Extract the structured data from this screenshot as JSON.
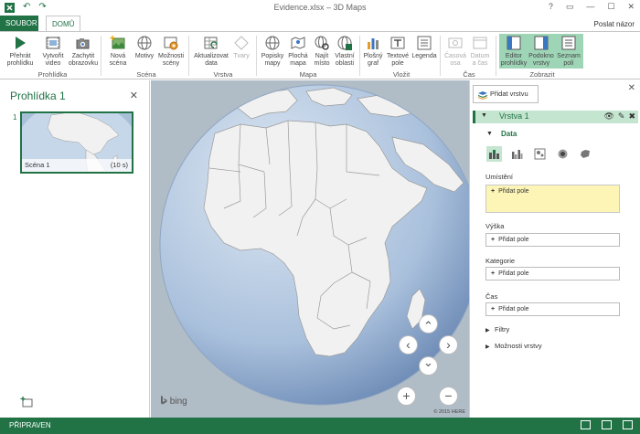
{
  "window": {
    "title": "Evidence.xlsx – 3D Maps",
    "help": "?",
    "restore": "▭",
    "minimize": "—",
    "maximize": "☐",
    "close": "✕"
  },
  "qat": {
    "undo": "↶",
    "redo": "↷"
  },
  "tabs": {
    "file": "SOUBOR",
    "home": "DOMŮ"
  },
  "signin": "Poslat názor",
  "ribbon": {
    "tour": {
      "play": "Přehrát prohlídku",
      "create_video": "Vytvořit video",
      "capture": "Zachytit obrazovku",
      "label": "Prohlídka"
    },
    "scene": {
      "new_scene": "Nová scéna",
      "themes": "Motivy",
      "options": "Možnosti scény",
      "label": "Scéna"
    },
    "layer": {
      "refresh": "Aktualizovat data",
      "shapes": "Tvary",
      "label": "Vrstva"
    },
    "map": {
      "labels": "Popisky mapy",
      "flat_map": "Plochá mapa",
      "find": "Najít místo",
      "custom": "Vlastní oblasti",
      "label": "Mapa"
    },
    "insert": {
      "flat_chart": "Plošný graf",
      "text_box": "Textové pole",
      "legend": "Legenda",
      "label": "Vložit"
    },
    "time": {
      "timeline": "Časová osa",
      "date_time": "Datum a čas",
      "label": "Čas"
    },
    "view": {
      "tour_editor": "Editor prohlídky",
      "layer_pane": "Podokno vrstvy",
      "field_list": "Seznam polí",
      "label": "Zobrazit"
    }
  },
  "left_panel": {
    "title": "Prohlídka 1",
    "close": "✕",
    "scenes": [
      {
        "index": "1",
        "name": "Scéna 1",
        "duration": "(10 s)"
      }
    ]
  },
  "map": {
    "bing": "bing",
    "copyright": "© 2015 HERE",
    "controls": {
      "up": "⌃",
      "down": "⌄",
      "left": "‹",
      "right": "›",
      "zoom_in": "+",
      "zoom_out": "−"
    }
  },
  "right_panel": {
    "close": "✕",
    "add_layer": "Přidat vrstvu",
    "layer_name": "Vrstva 1",
    "data_label": "Data",
    "fields": {
      "location": {
        "label": "Umístění",
        "placeholder": "Přidat pole"
      },
      "height": {
        "label": "Výška",
        "placeholder": "Přidat pole"
      },
      "category": {
        "label": "Kategorie",
        "placeholder": "Přidat pole"
      },
      "time": {
        "label": "Čas",
        "placeholder": "Přidat pole"
      }
    },
    "filters": "Filtry",
    "layer_options": "Možnosti vrstvy"
  },
  "status": {
    "text": "PŘIPRAVEN"
  },
  "colors": {
    "accent": "#217346",
    "accent_light": "#c4e5d0",
    "view_group": "#9fd5b7",
    "ocean": "#b0bcc6",
    "globe_light": "#dde7f2",
    "globe_dark": "#5878a8",
    "land": "#f1f1f1",
    "location_field": "#fdf5b6"
  }
}
